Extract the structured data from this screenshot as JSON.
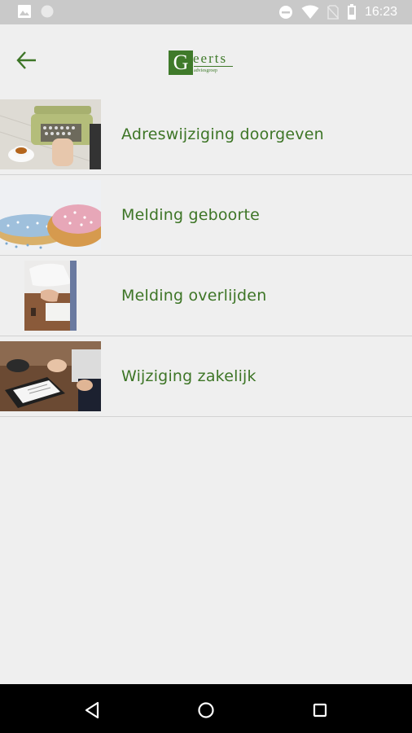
{
  "status_bar": {
    "time": "16:23",
    "icons": [
      "image-icon",
      "circle-icon",
      "do-not-disturb-icon",
      "wifi-icon",
      "no-sim-icon",
      "battery-icon"
    ]
  },
  "header": {
    "back_icon": "arrow-left-icon",
    "logo": {
      "letter": "G",
      "text": "eerts",
      "subtext": "adviesgroep"
    }
  },
  "menu_items": [
    {
      "label": "Adreswijziging doorgeven",
      "thumbnail": "typewriter-photo"
    },
    {
      "label": "Melding geboorte",
      "thumbnail": "beschuit-met-muisjes-photo"
    },
    {
      "label": "Melding overlijden",
      "thumbnail": "handshake-office-photo"
    },
    {
      "label": "Wijziging zakelijk",
      "thumbnail": "business-meeting-photo"
    }
  ],
  "nav_bar": {
    "buttons": [
      "back-triangle-icon",
      "home-circle-icon",
      "recents-square-icon"
    ]
  },
  "colors": {
    "accent": "#3d7526",
    "background": "#efefef",
    "status_bar": "#c9c9c9",
    "divider": "#d2d2d2"
  }
}
